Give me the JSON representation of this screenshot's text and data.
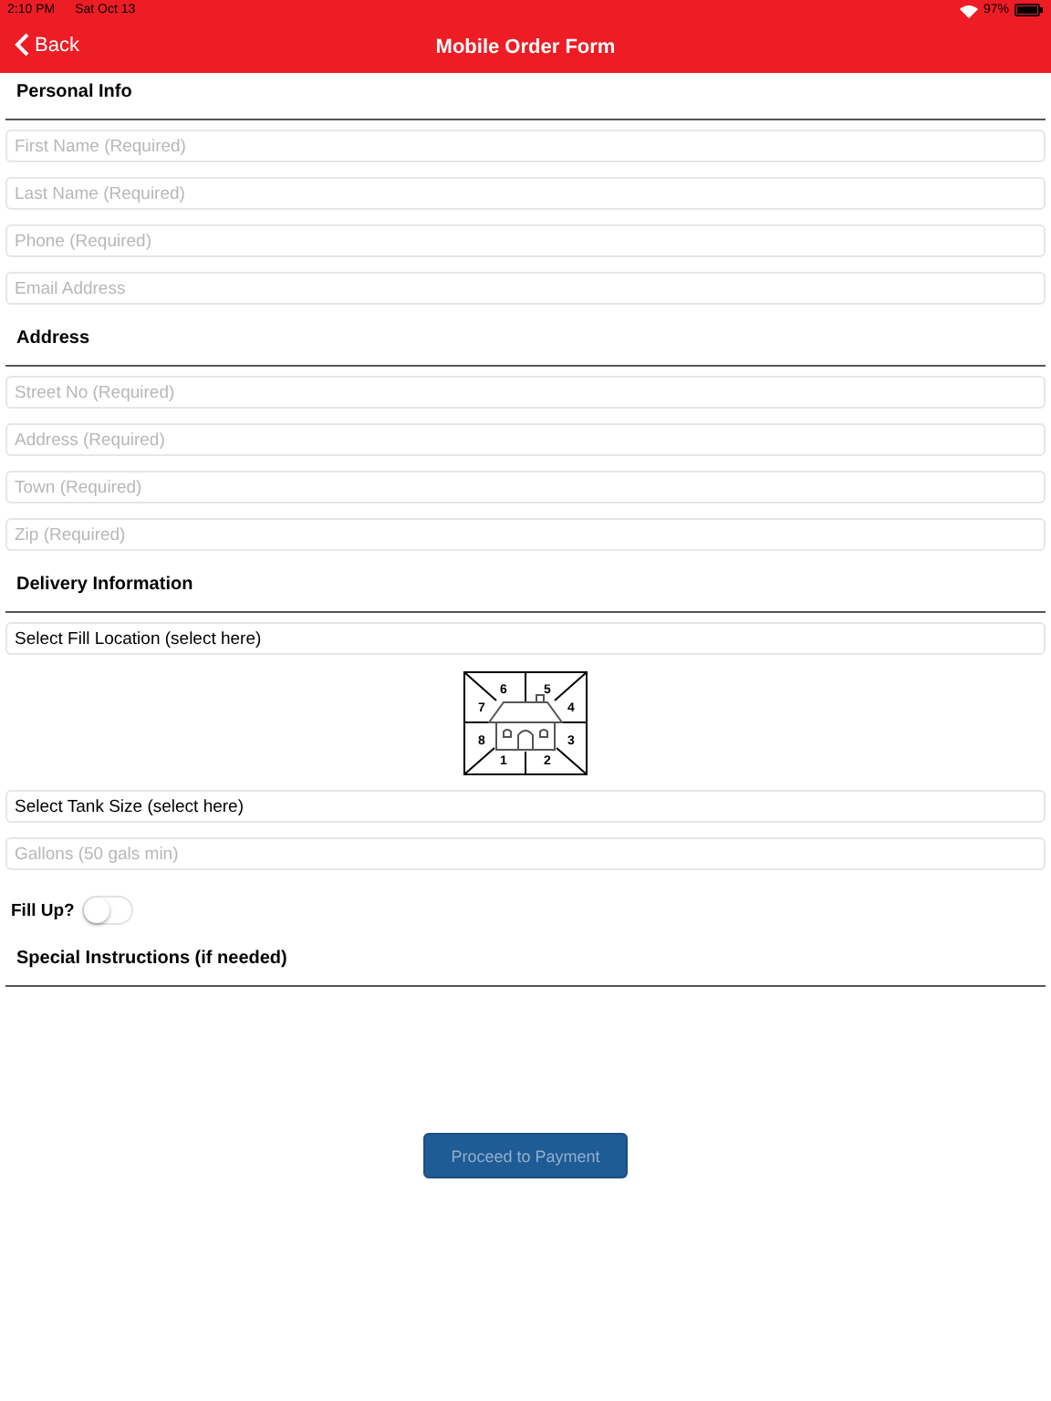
{
  "status_bar": {
    "time": "2:10 PM",
    "date": "Sat Oct 13",
    "battery": "97%"
  },
  "nav": {
    "back": "Back",
    "title": "Mobile Order Form"
  },
  "sections": [
    {
      "title": "Personal Info",
      "items": [
        {
          "kind": "field",
          "placeholder": "First Name (Required)"
        },
        {
          "kind": "field",
          "placeholder": "Last Name (Required)"
        },
        {
          "kind": "field",
          "placeholder": "Phone (Required)"
        },
        {
          "kind": "field",
          "placeholder": "Email Address"
        }
      ]
    },
    {
      "title": "Address",
      "items": [
        {
          "kind": "field",
          "placeholder": "Street No (Required)"
        },
        {
          "kind": "field",
          "placeholder": "Address (Required)"
        },
        {
          "kind": "field",
          "placeholder": "Town (Required)"
        },
        {
          "kind": "field",
          "placeholder": "Zip (Required)"
        }
      ]
    },
    {
      "title": "Delivery Information",
      "items": [
        {
          "kind": "select",
          "label": "Select Fill Location (select here)"
        },
        {
          "kind": "diagram",
          "labels": [
            "1",
            "2",
            "3",
            "4",
            "5",
            "6",
            "7",
            "8"
          ]
        },
        {
          "kind": "select",
          "label": "Select Tank Size (select here)"
        },
        {
          "kind": "field",
          "placeholder": "Gallons (50 gals min)"
        },
        {
          "kind": "toggle",
          "label": "Fill Up?",
          "on": false
        }
      ]
    },
    {
      "title": "Special Instructions (if needed)"
    }
  ],
  "button": {
    "label": "Proceed to Payment",
    "disabled": true
  }
}
